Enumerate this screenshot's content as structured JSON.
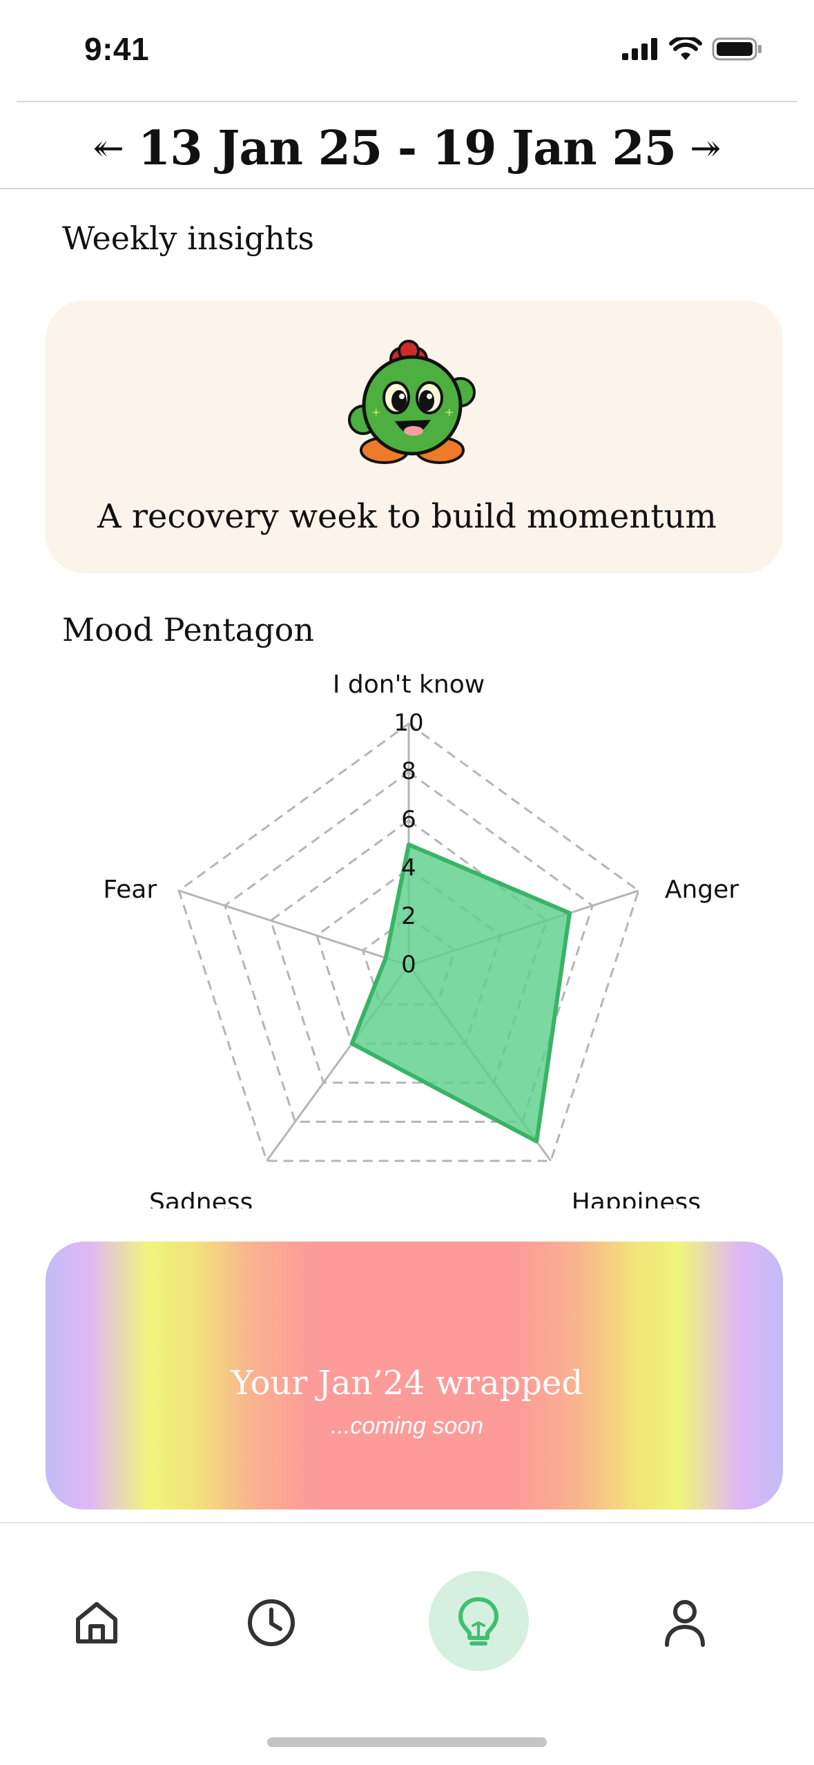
{
  "status_bar": {
    "time": "9:41",
    "icons": [
      "signal-icon",
      "wifi-icon",
      "battery-icon"
    ]
  },
  "week_nav": {
    "prev_icon": "double-chevron-left-icon",
    "range": "13 Jan 25 - 19 Jan 25",
    "next_icon": "double-chevron-right-icon"
  },
  "weekly_insights": {
    "title": "Weekly insights",
    "mascot": "cactus-mascot-icon",
    "message": "A recovery week to build momentum"
  },
  "mood_pentagon": {
    "title": "Mood Pentagon"
  },
  "chart_data": {
    "type": "radar",
    "axes": [
      "I don't know",
      "Anger",
      "Happiness",
      "Sadness",
      "Fear"
    ],
    "values": [
      5,
      7,
      9,
      4,
      1
    ],
    "ticks": [
      "0",
      "2",
      "4",
      "6",
      "8",
      "10"
    ],
    "range": [
      0,
      10
    ],
    "grid": "dashed",
    "fill_color": "#5ecf8b",
    "stroke_color": "#38b466"
  },
  "wrapped": {
    "title": "Your Jan’24 wrapped",
    "subtitle": "...coming soon"
  },
  "tab_bar": {
    "tabs": [
      {
        "name": "home",
        "icon": "home-icon",
        "active": false
      },
      {
        "name": "history",
        "icon": "clock-icon",
        "active": false
      },
      {
        "name": "insights",
        "icon": "lightbulb-icon",
        "active": true
      },
      {
        "name": "profile",
        "icon": "user-icon",
        "active": false
      }
    ],
    "active_color": "#3fbf72"
  }
}
